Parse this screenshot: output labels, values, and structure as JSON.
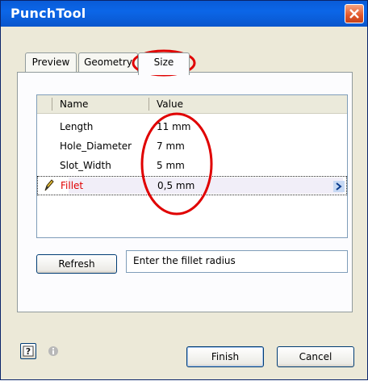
{
  "window": {
    "title": "PunchTool"
  },
  "tabs": [
    {
      "label": "Preview"
    },
    {
      "label": "Geometry"
    },
    {
      "label": "Size"
    }
  ],
  "grid": {
    "columns": [
      "Name",
      "Value"
    ],
    "rows": [
      {
        "name": "Length",
        "value": "11 mm"
      },
      {
        "name": "Hole_Diameter",
        "value": "7 mm"
      },
      {
        "name": "Slot_Width",
        "value": "5 mm"
      },
      {
        "name": "Fillet",
        "value": "0,5 mm",
        "selected": true
      }
    ]
  },
  "refresh_label": "Refresh",
  "hint": "Enter the fillet radius",
  "buttons": {
    "finish": "Finish",
    "cancel": "Cancel"
  },
  "colors": {
    "title_bar": "#0b66e8",
    "selected_name": "#e00000",
    "annotation": "#e00000"
  },
  "icons": [
    "close-icon",
    "pencil-icon",
    "expand-arrow-icon",
    "help-icon",
    "info-icon"
  ]
}
